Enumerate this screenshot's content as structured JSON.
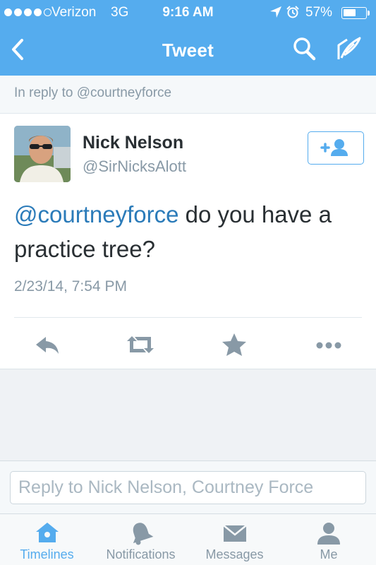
{
  "colors": {
    "accent": "#55acee",
    "link": "#2b7bb9",
    "muted": "#8899a6",
    "text": "#292f33",
    "icon_gray": "#8899a6"
  },
  "status_bar": {
    "signal_filled": 4,
    "signal_total": 5,
    "carrier": "Verizon",
    "network": "3G",
    "time": "9:16 AM",
    "battery_percent_label": "57%",
    "battery_level": 0.57,
    "icons": [
      "location-arrow-icon",
      "alarm-icon",
      "battery-icon"
    ]
  },
  "nav": {
    "title": "Tweet",
    "icons": [
      "back-chevron-icon",
      "search-icon",
      "compose-icon"
    ]
  },
  "reply_context": {
    "text": "In reply to @courtneyforce"
  },
  "tweet": {
    "user": {
      "name": "Nick Nelson",
      "handle": "@SirNicksAlott"
    },
    "follow_icon": "follow-user-icon",
    "mention": "@courtneyforce",
    "body": " do you have a practice tree?",
    "timestamp": "2/23/14, 7:54 PM",
    "actions": [
      "reply-icon",
      "retweet-icon",
      "favorite-star-icon",
      "more-icon"
    ]
  },
  "compose": {
    "placeholder": "Reply to Nick Nelson, Courtney Force",
    "value": ""
  },
  "tabbar": {
    "items": [
      {
        "label": "Timelines",
        "icon": "home-icon",
        "active": true
      },
      {
        "label": "Notifications",
        "icon": "bell-icon",
        "active": false
      },
      {
        "label": "Messages",
        "icon": "envelope-icon",
        "active": false
      },
      {
        "label": "Me",
        "icon": "person-icon",
        "active": false
      }
    ]
  }
}
